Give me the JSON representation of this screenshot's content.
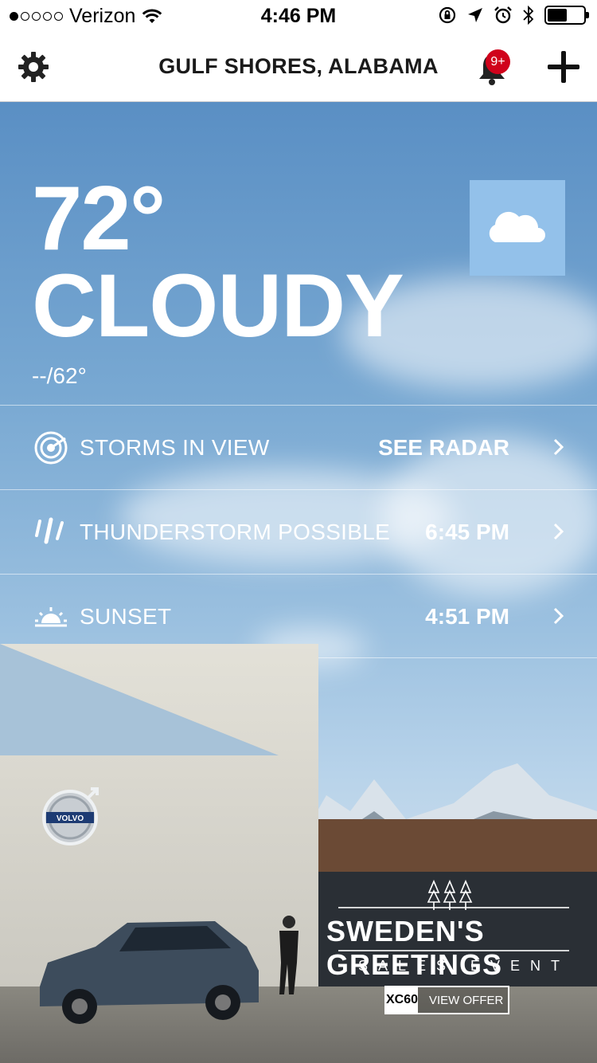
{
  "status_bar": {
    "carrier": "Verizon",
    "signal_bars": 1,
    "time": "4:46 PM",
    "battery_level": 0.55
  },
  "nav": {
    "location": "GULF SHORES, ALABAMA",
    "notification_badge": "9+",
    "icons": [
      "gear-icon",
      "bell-icon",
      "plus-icon"
    ]
  },
  "current": {
    "temperature": "72°",
    "condition": "CLOUDY",
    "hi_lo": "--/62°",
    "condition_icon": "cloud-icon"
  },
  "rows": [
    {
      "label": "STORMS IN VIEW",
      "value": "SEE RADAR",
      "icon": "radar-icon"
    },
    {
      "label": "THUNDERSTORM POSSIBLE",
      "value": "6:45 PM",
      "icon": "rain-icon"
    },
    {
      "label": "SUNSET",
      "value": "4:51 PM",
      "icon": "sunset-icon"
    }
  ],
  "ad": {
    "brand": "VOLVO",
    "headline": "SWEDEN'S GREETINGS",
    "subline": "SALES EVENT",
    "model": "XC60",
    "cta": "VIEW OFFER"
  },
  "colors": {
    "badge": "#d0021b",
    "cloud_box": "#93c1ea",
    "sky_top": "#5a8fc4"
  }
}
